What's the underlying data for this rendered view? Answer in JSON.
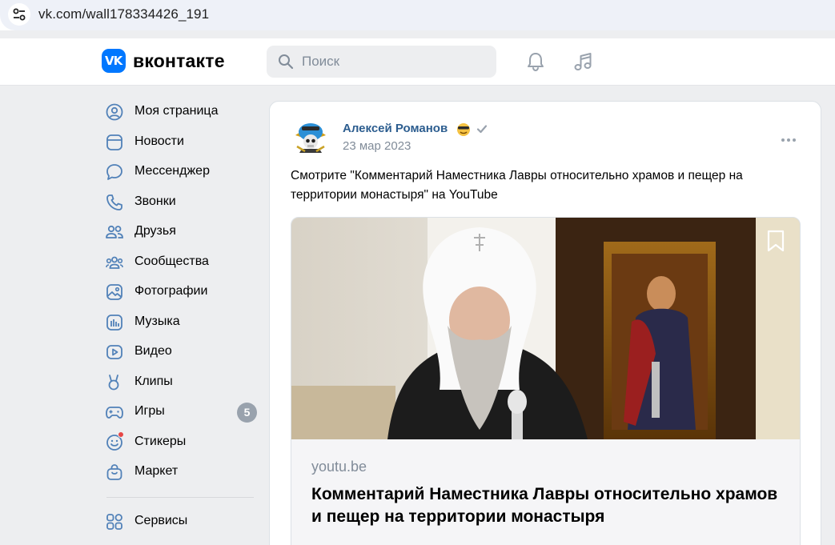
{
  "browser": {
    "url": "vk.com/wall178334426_191",
    "site_settings_icon": "tune-icon"
  },
  "header": {
    "logo_text": "VK",
    "brand": "вконтакте",
    "search_placeholder": "Поиск",
    "icons": [
      "bell-icon",
      "music-note-icon"
    ],
    "colors": {
      "brand": "#0077ff",
      "link": "#2c5d8f"
    }
  },
  "menu": {
    "items": [
      {
        "label": "Моя страница",
        "icon": "user-circle-icon"
      },
      {
        "label": "Новости",
        "icon": "newsfeed-icon"
      },
      {
        "label": "Мессенджер",
        "icon": "chat-bubble-icon"
      },
      {
        "label": "Звонки",
        "icon": "phone-icon"
      },
      {
        "label": "Друзья",
        "icon": "friends-icon"
      },
      {
        "label": "Сообщества",
        "icon": "communities-icon"
      },
      {
        "label": "Фотографии",
        "icon": "photo-icon"
      },
      {
        "label": "Музыка",
        "icon": "music-icon"
      },
      {
        "label": "Видео",
        "icon": "video-icon"
      },
      {
        "label": "Клипы",
        "icon": "clips-icon"
      },
      {
        "label": "Игры",
        "icon": "gamepad-icon",
        "badge": "5"
      },
      {
        "label": "Стикеры",
        "icon": "smile-icon"
      },
      {
        "label": "Маркет",
        "icon": "bag-icon"
      }
    ],
    "services": {
      "label": "Сервисы",
      "icon": "services-grid-icon"
    }
  },
  "post": {
    "author": "Алексей Романов",
    "date": "23 мар 2023",
    "text": "Смотрите \"Комментарий Наместника Лавры относительно храмов и пещер на территории монастыря\" на YouTube",
    "link": {
      "domain": "youtu.be",
      "title": "Комментарий Наместника Лавры относительно храмов и пещер на территории монастыря"
    }
  }
}
